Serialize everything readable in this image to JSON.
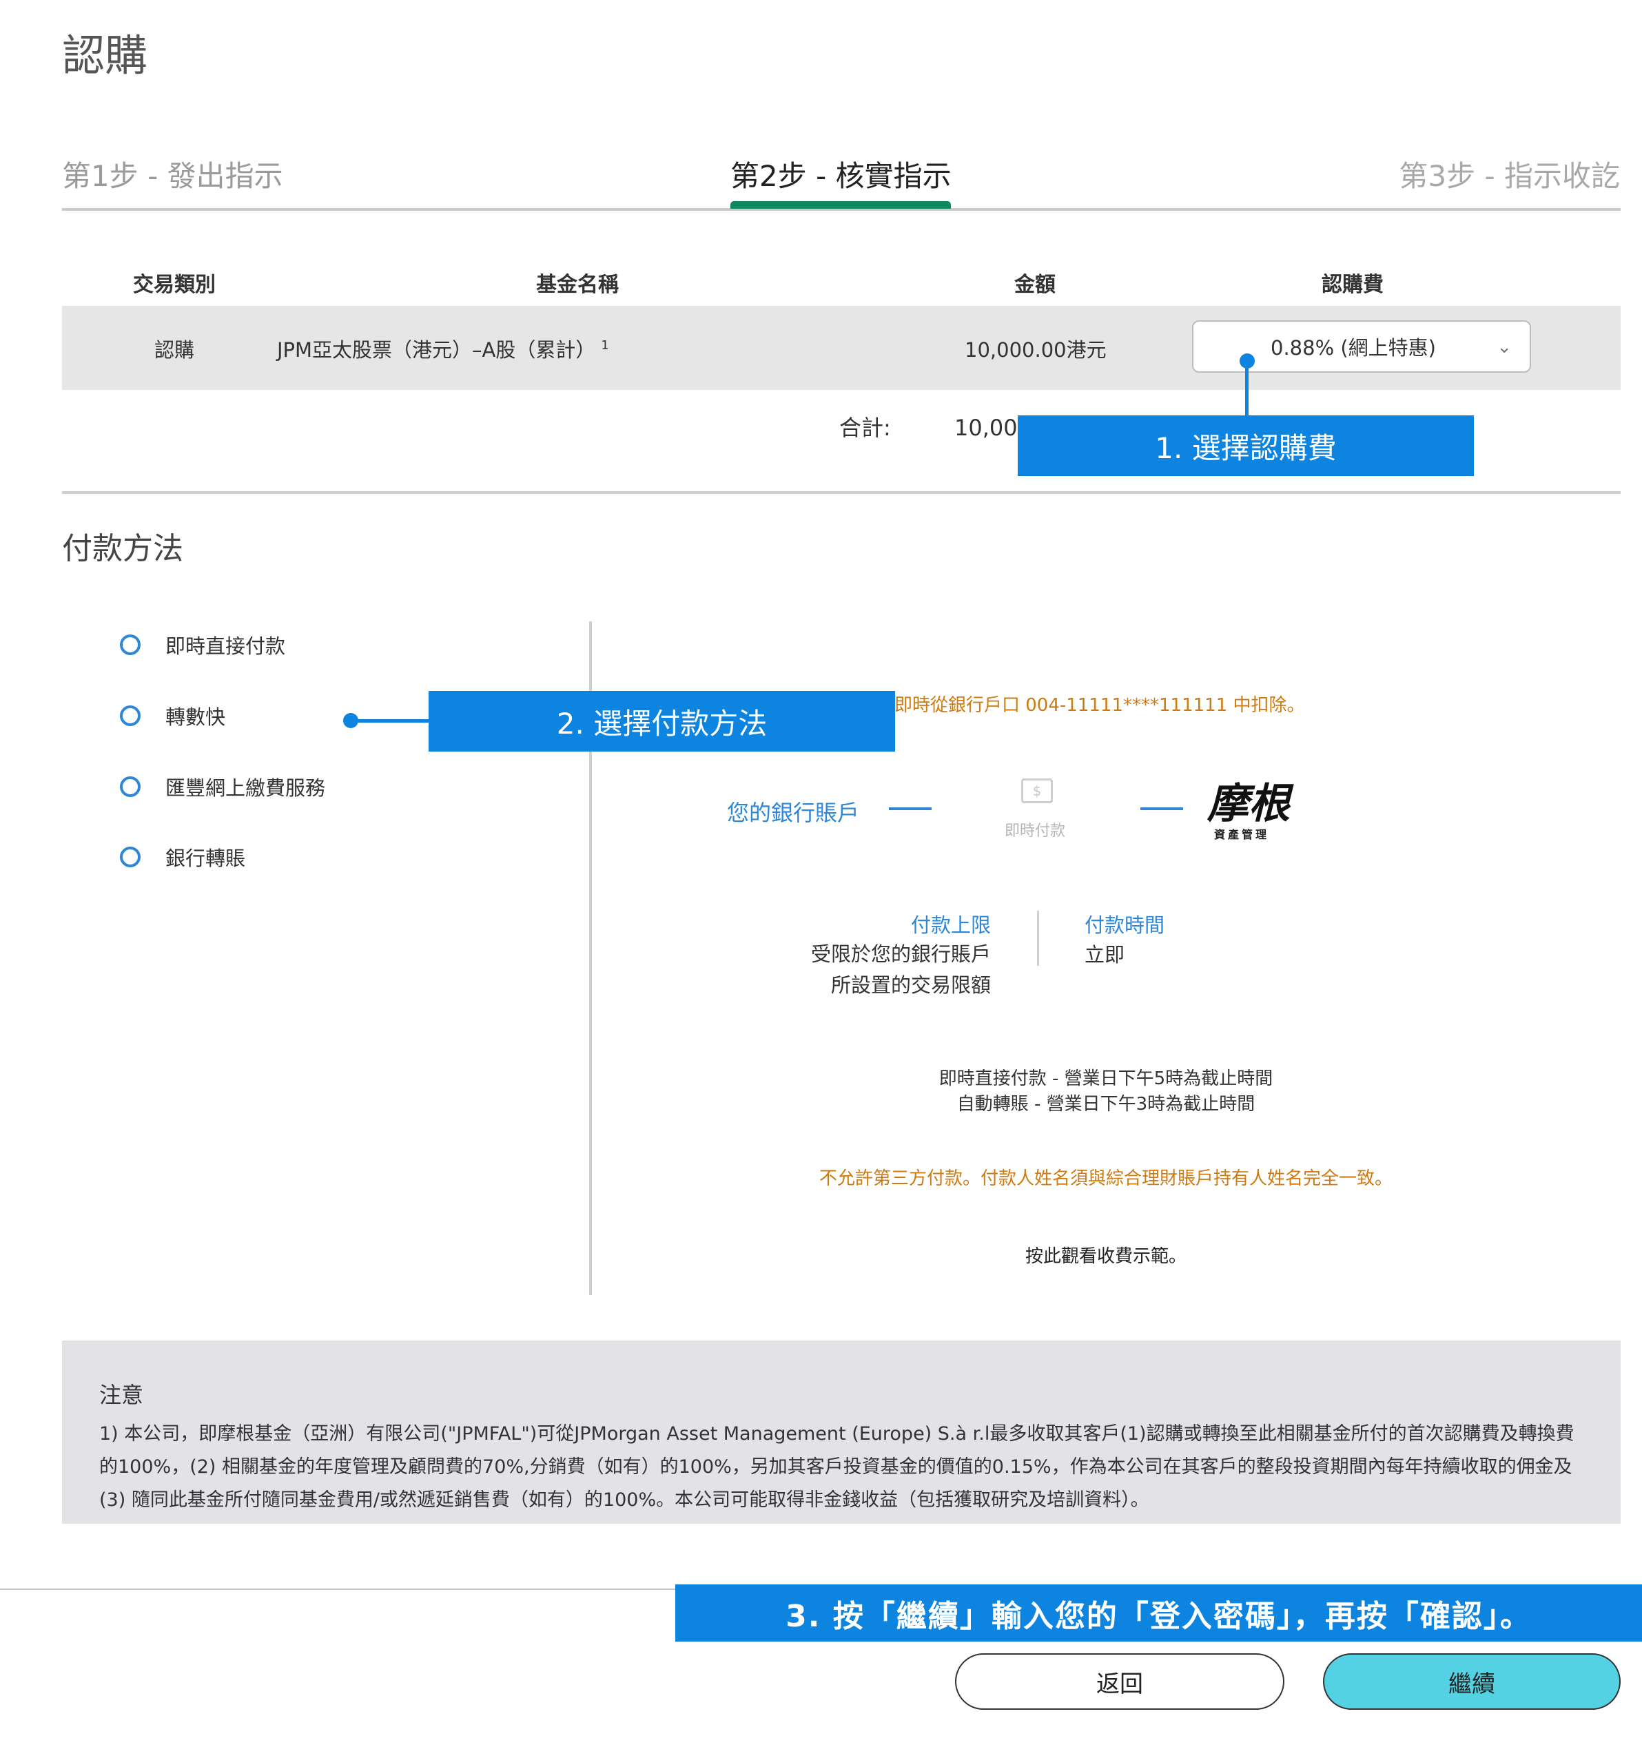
{
  "page": {
    "title": "認購"
  },
  "steps": {
    "step1": "第1步 - 發出指示",
    "step2": "第2步 - 核實指示",
    "step3": "第3步 - 指示收訖"
  },
  "table": {
    "headers": {
      "type": "交易類別",
      "fund": "基金名稱",
      "amount": "金額",
      "fee": "認購費"
    },
    "row": {
      "type": "認購",
      "fund": "JPM亞太股票（港元）–A股（累計）",
      "fund_note": "1",
      "amount": "10,000.00港元",
      "fee_selected": "0.88% (網上特惠)"
    },
    "total_label": "合計:",
    "total_value": "10,000.00港元"
  },
  "callouts": {
    "c1": "1.  選擇認購費",
    "c2": "2.  選擇付款方法",
    "c3": "3. 按「繼續」輸入您的「登入密碼」，再按「確認」。"
  },
  "payment": {
    "title": "付款方法",
    "options": [
      "即時直接付款",
      "轉數快",
      "匯豐網上繳費服務",
      "銀行轉賬"
    ],
    "deduct_note": "即時從銀行戶口 004-11111****111111 中扣除。",
    "bank_account": "您的銀行賬戶",
    "instant_label": "即時付款",
    "logo_main": "摩根",
    "logo_sub": "資產管理",
    "limit_title": "付款上限",
    "limit_text_1": "受限於您的銀行賬戶",
    "limit_text_2": "所設置的交易限額",
    "time_title": "付款時間",
    "time_text": "立即",
    "cutoff_1": "即時直接付款 - 營業日下午5時為截止時間",
    "cutoff_2": "自動轉賬 - 營業日下午3時為截止時間",
    "third_party": "不允許第三方付款。付款人姓名須與綜合理財賬戶持有人姓名完全一致。",
    "demo_link": "按此觀看收費示範。"
  },
  "notice": {
    "title": "注意",
    "text": "1) 本公司，即摩根基金（亞洲）有限公司(\"JPMFAL\")可從JPMorgan Asset Management (Europe) S.à r.l最多收取其客戶(1)認購或轉換至此相關基金所付的首次認購費及轉換費的100%，(2) 相關基金的年度管理及顧問費的70%,分銷費（如有）的100%，另加其客戶投資基金的價值的0.15%，作為本公司在其客戶的整段投資期間內每年持續收取的佣金及 (3) 隨同此基金所付隨同基金費用/或然遞延銷售費（如有）的100%。本公司可能取得非金錢收益（包括獲取研究及培訓資料）。"
  },
  "buttons": {
    "back": "返回",
    "continue": "繼續"
  },
  "colors": {
    "accent_green": "#0f8a5f",
    "callout_blue": "#0d84e0",
    "link_blue": "#2d86d8",
    "warning_orange": "#d07a12",
    "continue_button": "#54d2e3"
  }
}
